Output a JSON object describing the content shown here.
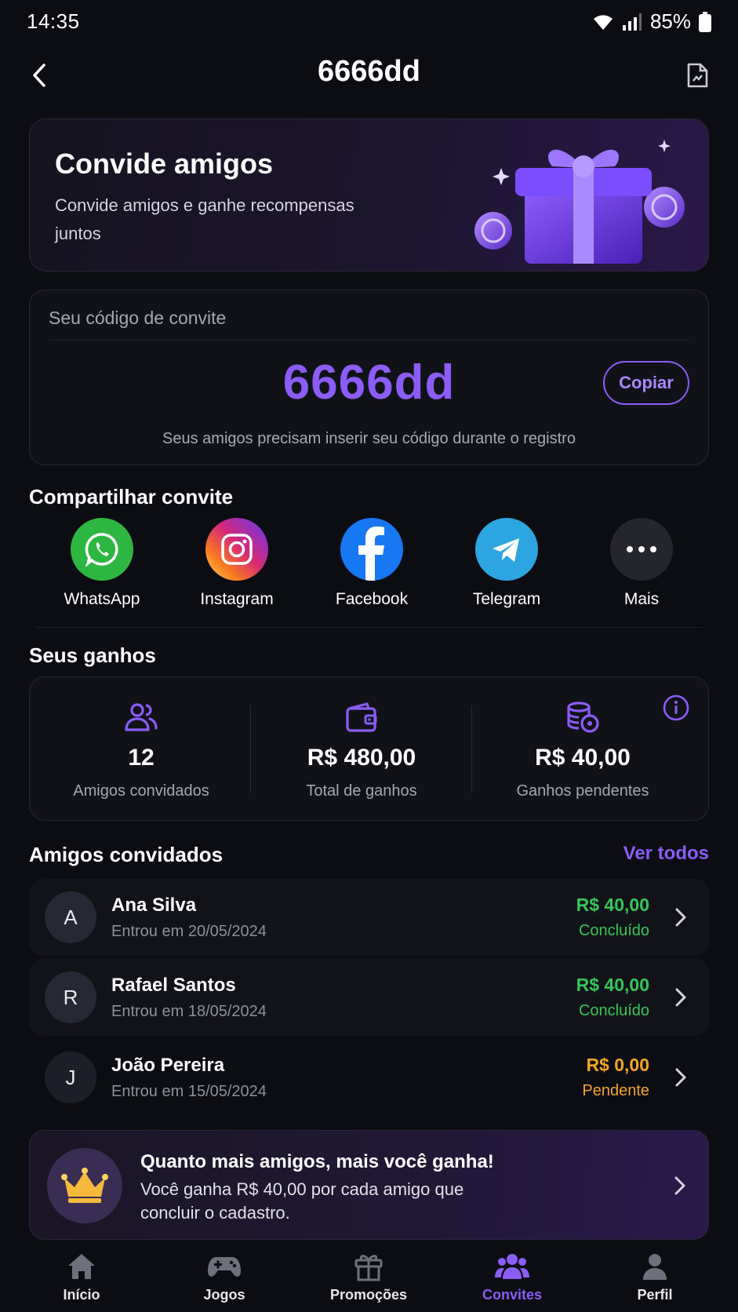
{
  "status_bar": {
    "time": "14:35",
    "battery": "85%"
  },
  "header": {
    "title": "6666dd",
    "back_icon": "chevron-left-icon",
    "action_icon": "document-icon"
  },
  "hero": {
    "title": "Convide amigos",
    "subtitle_line1": "Convide amigos e ganhe recompensas",
    "subtitle_line2": "juntos",
    "image": "gift-box-illustration"
  },
  "invite_code": {
    "label": "Seu código de convite",
    "code": "6666dd",
    "copy_label": "Copiar",
    "note": "Seus amigos precisam inserir seu código durante o registro"
  },
  "share": {
    "title": "Compartilhar convite",
    "items": [
      {
        "label": "WhatsApp",
        "icon": "whatsapp-icon",
        "color": "#2db742"
      },
      {
        "label": "Instagram",
        "icon": "instagram-icon",
        "color": "#e1306c"
      },
      {
        "label": "Facebook",
        "icon": "facebook-icon",
        "color": "#1877f2"
      },
      {
        "label": "Telegram",
        "icon": "telegram-icon",
        "color": "#2ca5e0"
      },
      {
        "label": "Mais",
        "icon": "more-icon",
        "color": "#24252d"
      }
    ]
  },
  "earnings": {
    "title": "Seus ganhos",
    "stats": [
      {
        "value": "12",
        "label": "Amigos convidados",
        "icon": "users-icon"
      },
      {
        "value": "R$ 480,00",
        "label": "Total de ganhos",
        "icon": "wallet-icon"
      },
      {
        "value": "R$ 40,00",
        "label": "Ganhos pendentes",
        "icon": "coins-icon"
      }
    ],
    "info_icon": "info-icon"
  },
  "friends": {
    "title": "Amigos convidados",
    "see_all": "Ver todos",
    "list": [
      {
        "initial": "A",
        "name": "Ana Silva",
        "date": "Entrou em 20/05/2024",
        "amount": "R$ 40,00",
        "status": "Concluído",
        "status_color": "#34c759"
      },
      {
        "initial": "R",
        "name": "Rafael Santos",
        "date": "Entrou em 18/05/2024",
        "amount": "R$ 40,00",
        "status": "Concluído",
        "status_color": "#34c759"
      },
      {
        "initial": "J",
        "name": "João Pereira",
        "date": "Entrou em 15/05/2024",
        "amount": "R$ 0,00",
        "status": "Pendente",
        "status_color": "#f5a524"
      }
    ]
  },
  "promo": {
    "title": "Quanto mais amigos, mais você ganha!",
    "text_line1": "Você ganha R$ 40,00 por cada amigo que",
    "text_line2": "concluir o cadastro.",
    "icon": "crown-icon"
  },
  "bottom_nav": {
    "items": [
      {
        "label": "Início",
        "icon": "home-icon"
      },
      {
        "label": "Jogos",
        "icon": "gamepad-icon"
      },
      {
        "label": "Promoções",
        "icon": "gift-icon"
      },
      {
        "label": "Convites",
        "icon": "people-icon",
        "active": true
      },
      {
        "label": "Perfil",
        "icon": "profile-icon"
      }
    ]
  },
  "colors": {
    "accent": "#8b5cf6",
    "success": "#34c759",
    "warning": "#f5a524",
    "background": "#0c0d12"
  }
}
